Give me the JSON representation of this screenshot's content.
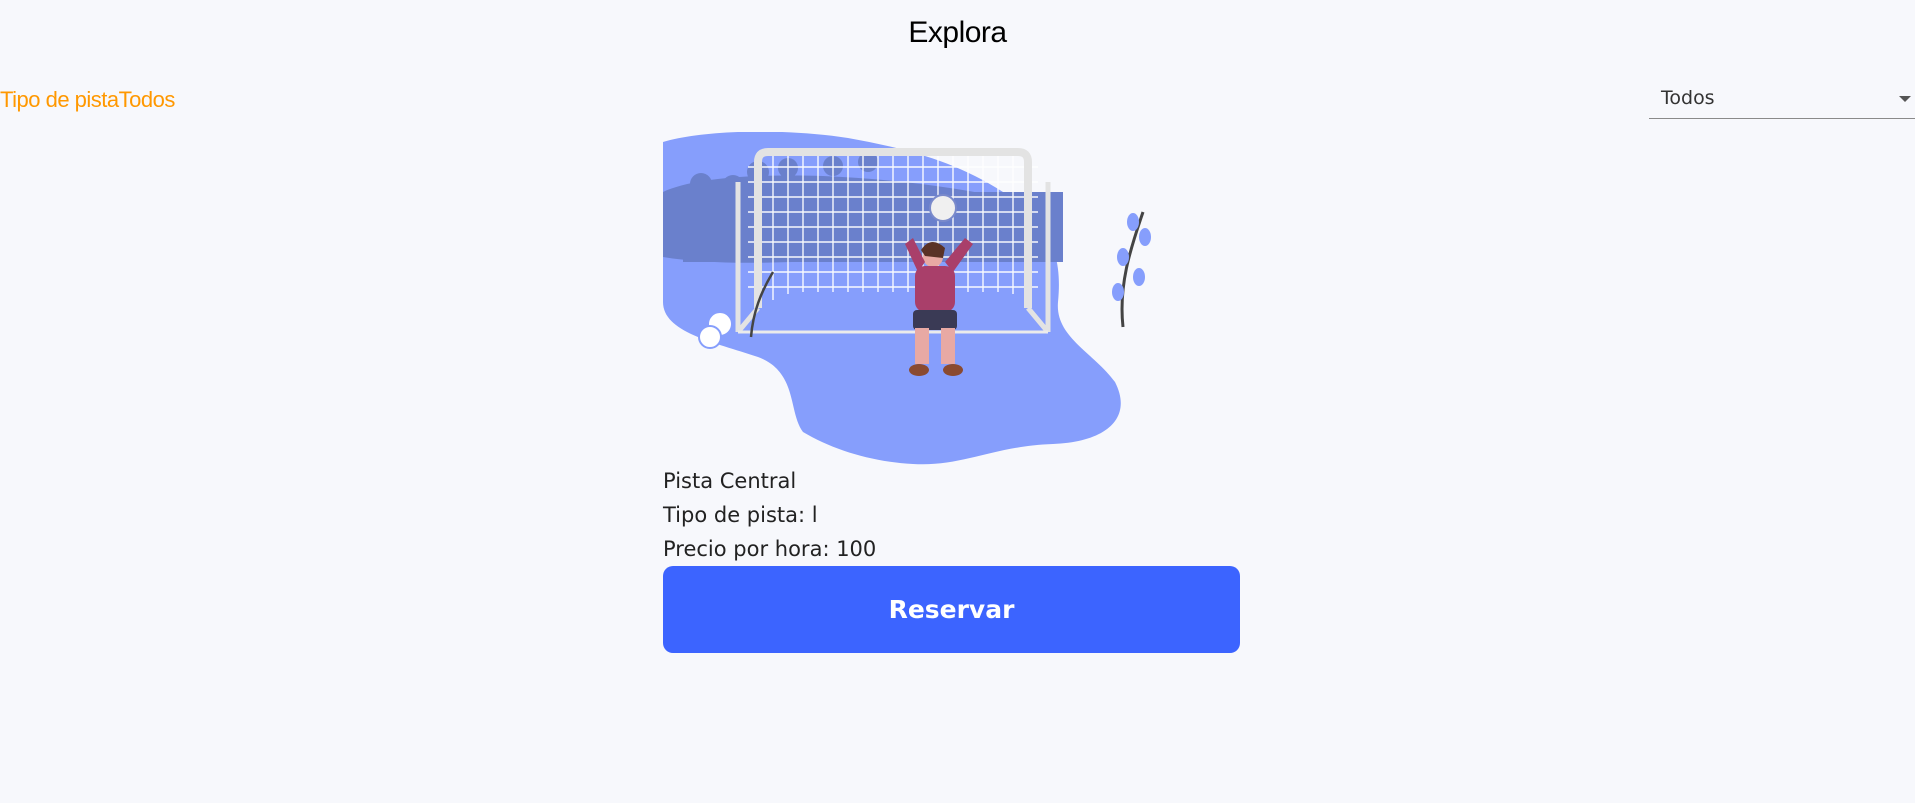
{
  "header": {
    "title": "Explora"
  },
  "filter": {
    "label": "Tipo de pistaTodos",
    "selected": "Todos",
    "icon": "caret-down-icon"
  },
  "card": {
    "image_icon": "goalkeeper-illustration",
    "name": "Pista Central",
    "type_line": "Tipo de pista: l",
    "price_line": "Precio por hora: 100",
    "button_label": "Reservar"
  },
  "colors": {
    "background": "#f7f8fc",
    "accent_orange": "#ff9800",
    "button_blue": "#3c64ff",
    "illustration_blue": "#869efc"
  }
}
